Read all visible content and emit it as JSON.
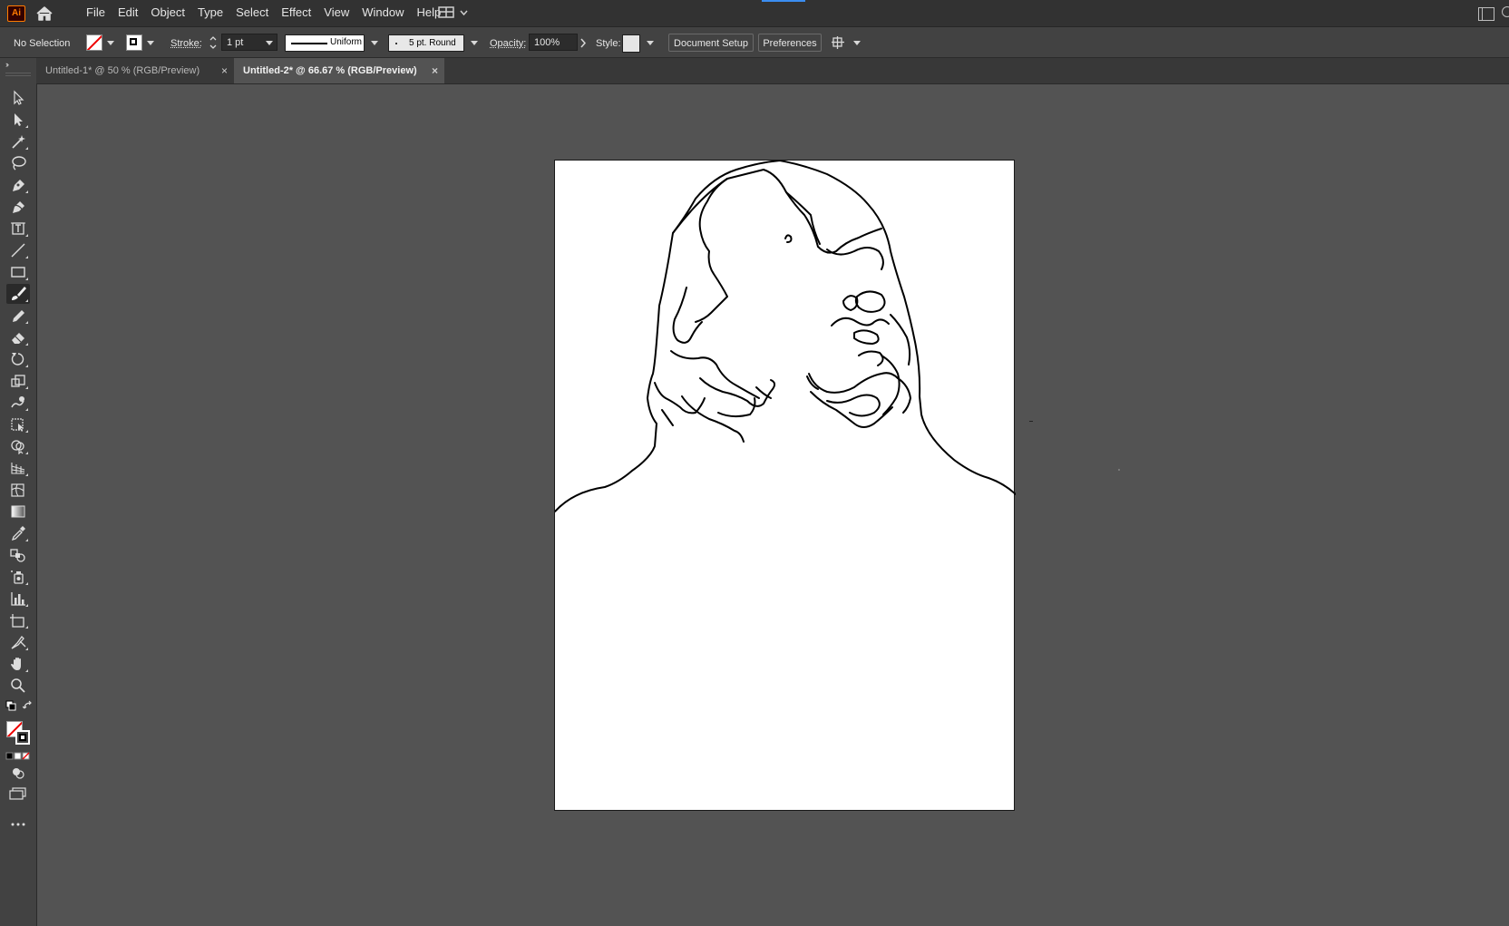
{
  "app": {
    "logo_text": "Ai",
    "menu": [
      "File",
      "Edit",
      "Object",
      "Type",
      "Select",
      "Effect",
      "View",
      "Window",
      "Help"
    ]
  },
  "control_bar": {
    "selection_status": "No Selection",
    "stroke_label": "Stroke:",
    "stroke_weight": "1 pt",
    "stroke_profile": "Uniform",
    "brush": "5 pt. Round",
    "opacity_label": "Opacity:",
    "opacity_value": "100%",
    "style_label": "Style:",
    "document_setup_label": "Document Setup",
    "preferences_label": "Preferences",
    "fill_color": "none",
    "stroke_color": "#000000"
  },
  "tabs": [
    {
      "label": "Untitled-1* @ 50 % (RGB/Preview)",
      "active": false
    },
    {
      "label": "Untitled-2* @ 66.67 % (RGB/Preview)",
      "active": true
    }
  ],
  "tools": [
    "selection-tool",
    "direct-selection-tool",
    "magic-wand-tool",
    "lasso-tool",
    "pen-tool",
    "curvature-tool",
    "artboard-type-tool",
    "line-segment-tool",
    "rectangle-tool",
    "paintbrush-tool",
    "pencil-tool",
    "eraser-tool",
    "rotate-tool",
    "scale-tool",
    "warp-tool",
    "free-transform-tool",
    "shape-builder-tool",
    "perspective-grid-tool",
    "mesh-tool",
    "gradient-tool",
    "eyedropper-tool",
    "blend-tool",
    "symbol-sprayer-tool",
    "column-graph-tool",
    "artboard-tool",
    "slice-tool",
    "hand-tool",
    "zoom-tool"
  ],
  "active_tool": "paintbrush-tool",
  "colors": {
    "app_bg": "#535353",
    "panel_bg": "#424242",
    "menubar_bg": "#323232",
    "artboard_bg": "#ffffff",
    "brand_orange": "#ff7c00"
  },
  "canvas": {
    "artwork_description_icon": "line-art-figure"
  }
}
